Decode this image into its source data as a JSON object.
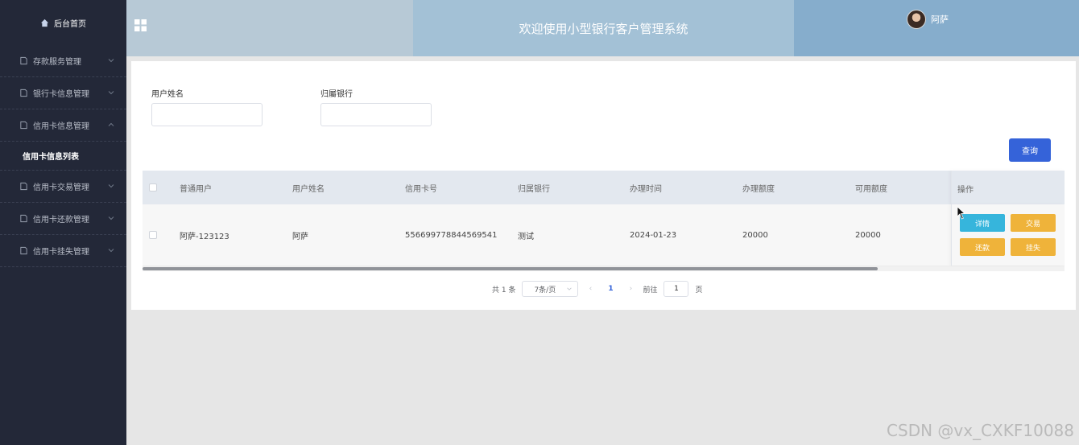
{
  "sidebar": {
    "home_label": "后台首页",
    "items": [
      {
        "label": "存款服务管理",
        "expanded": false
      },
      {
        "label": "银行卡信息管理",
        "expanded": false
      },
      {
        "label": "信用卡信息管理",
        "expanded": true
      },
      {
        "label": "信用卡交易管理",
        "expanded": false
      },
      {
        "label": "信用卡还款管理",
        "expanded": false
      },
      {
        "label": "信用卡挂失管理",
        "expanded": false
      }
    ],
    "subitem_label": "信用卡信息列表"
  },
  "header": {
    "title": "欢迎使用小型银行客户管理系统",
    "username": "阿萨"
  },
  "filters": {
    "name_label": "用户姓名",
    "name_value": "",
    "bank_label": "归屬银行",
    "bank_value": "",
    "search_button": "查询"
  },
  "table": {
    "columns": [
      "普通用户",
      "用户姓名",
      "信用卡号",
      "归属银行",
      "办理时间",
      "办理额度",
      "可用额度",
      "操作"
    ],
    "rows": [
      {
        "user": "阿萨-123123",
        "name": "阿萨",
        "card_no": "556699778844569541",
        "bank": "测试",
        "date": "2024-01-23",
        "limit": "20000",
        "available": "20000"
      }
    ],
    "actions": {
      "detail": "详情",
      "trade": "交易",
      "repay": "还款",
      "lost": "挂失"
    }
  },
  "pagination": {
    "total": "共 1 条",
    "page_size": "7条/页",
    "current_page": "1",
    "goto_label": "前往",
    "goto_value": "1",
    "page_suffix": "页"
  },
  "watermark": "CSDN @vx_CXKF10088",
  "colors": {
    "sidebar_bg": "#232838",
    "primary": "#3563d9",
    "info": "#36b5dc",
    "warning": "#efb33a"
  }
}
